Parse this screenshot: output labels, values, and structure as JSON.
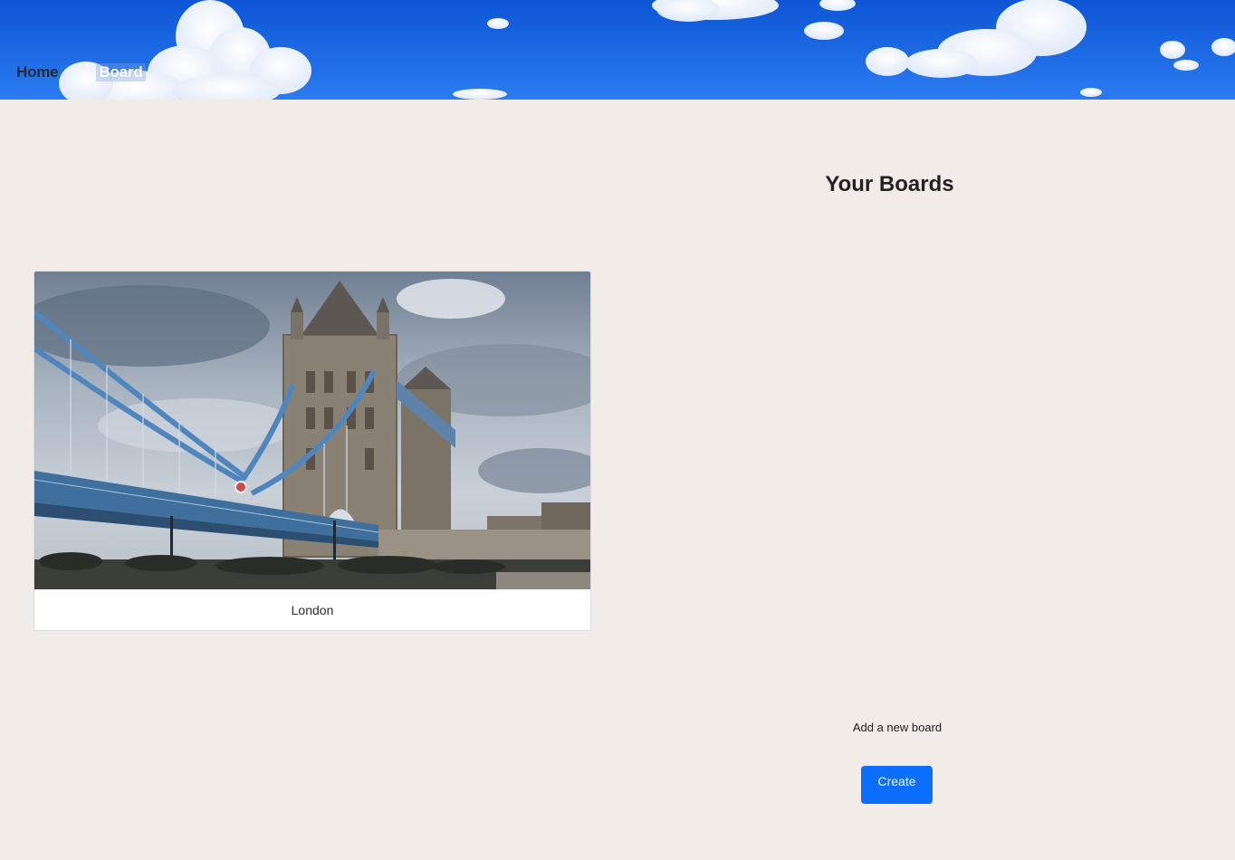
{
  "nav": {
    "home_label": "Home",
    "board_label": "Board"
  },
  "boards": [
    {
      "title": "London"
    }
  ],
  "sidebar": {
    "title": "Your Boards",
    "add_label": "Add a new board",
    "create_label": "Create"
  },
  "colors": {
    "sky": "#1a63e0",
    "page_background": "#f1ece8",
    "primary_button": "#0b6efd",
    "card_background": "#ffffff"
  },
  "icons": {
    "banner": "sky-clouds-banner",
    "board_thumbnail": "tower-bridge-photo"
  }
}
